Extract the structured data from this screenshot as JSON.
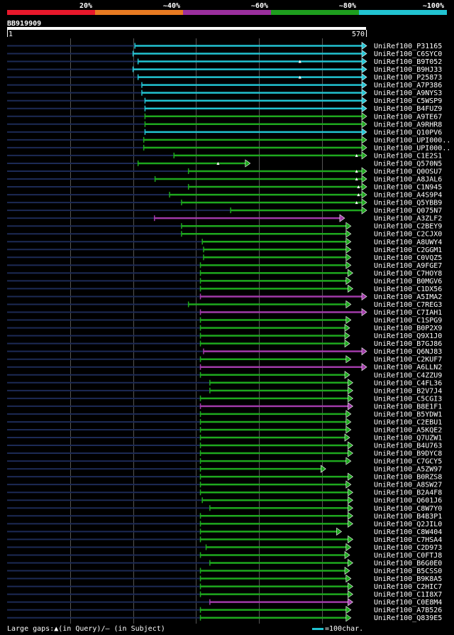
{
  "chart_data": {
    "type": "alignment-bars",
    "query_id": "BB919909",
    "query_length": 570,
    "query_start_label": "1",
    "query_end_label": "570",
    "identity_scale": [
      {
        "label": "20%",
        "color": "#e8182b"
      },
      {
        "label": "~40%",
        "color": "#e87b22"
      },
      {
        "label": "~60%",
        "color": "#9b2f9e"
      },
      {
        "label": "~80%",
        "color": "#1e9e1e"
      },
      {
        "label": "~100%",
        "color": "#22c3d1"
      }
    ],
    "hits": [
      {
        "name": "UniRef100_P31165",
        "start": 203,
        "end": 570,
        "color": "cyan"
      },
      {
        "name": "UniRef100_C6SYC0",
        "start": 200,
        "end": 570,
        "color": "cyan"
      },
      {
        "name": "UniRef100_B9T052",
        "start": 208,
        "end": 570,
        "color": "cyan",
        "gap_at": 465
      },
      {
        "name": "UniRef100_B9HJ33",
        "start": 200,
        "end": 570,
        "color": "cyan"
      },
      {
        "name": "UniRef100_P25873",
        "start": 208,
        "end": 570,
        "color": "cyan",
        "gap_at": 465
      },
      {
        "name": "UniRef100_A7P386",
        "start": 214,
        "end": 570,
        "color": "cyan"
      },
      {
        "name": "UniRef100_A9NYS3",
        "start": 214,
        "end": 570,
        "color": "cyan"
      },
      {
        "name": "UniRef100_C5WSP9",
        "start": 219,
        "end": 570,
        "color": "cyan"
      },
      {
        "name": "UniRef100_B4FUZ9",
        "start": 219,
        "end": 570,
        "color": "cyan"
      },
      {
        "name": "UniRef100_A9TE67",
        "start": 219,
        "end": 570,
        "color": "green"
      },
      {
        "name": "UniRef100_A9RHR8",
        "start": 219,
        "end": 570,
        "color": "green"
      },
      {
        "name": "UniRef100_Q10PV6",
        "start": 219,
        "end": 570,
        "color": "cyan"
      },
      {
        "name": "UniRef100_UPI000..",
        "start": 217,
        "end": 570,
        "color": "green"
      },
      {
        "name": "UniRef100_UPI000..",
        "start": 217,
        "end": 570,
        "color": "green"
      },
      {
        "name": "UniRef100_C1E2S1",
        "start": 265,
        "end": 570,
        "color": "green",
        "gap_at": 555
      },
      {
        "name": "UniRef100_Q570N5",
        "start": 208,
        "end": 385,
        "color": "green",
        "gap_at": 335
      },
      {
        "name": "UniRef100_Q0OSU7",
        "start": 288,
        "end": 570,
        "color": "green",
        "gap_at": 555
      },
      {
        "name": "UniRef100_A8JAL6",
        "start": 235,
        "end": 570,
        "color": "green",
        "gap_at": 555
      },
      {
        "name": "UniRef100_C1N945",
        "start": 288,
        "end": 570,
        "color": "green",
        "gap_at": 558
      },
      {
        "name": "UniRef100_A4S9P4",
        "start": 258,
        "end": 570,
        "color": "green",
        "gap_at": 558
      },
      {
        "name": "UniRef100_Q5YBB9",
        "start": 277,
        "end": 570,
        "color": "green",
        "gap_at": 555
      },
      {
        "name": "UniRef100_Q075N7",
        "start": 355,
        "end": 570,
        "color": "green"
      },
      {
        "name": "UniRef100_A3ZLF2",
        "start": 234,
        "end": 535,
        "color": "purple"
      },
      {
        "name": "UniRef100_C2BEY9",
        "start": 277,
        "end": 545,
        "color": "green"
      },
      {
        "name": "UniRef100_C2CJX0",
        "start": 277,
        "end": 545,
        "color": "green"
      },
      {
        "name": "UniRef100_A8UWY4",
        "start": 310,
        "end": 545,
        "color": "green"
      },
      {
        "name": "UniRef100_C2GGM1",
        "start": 312,
        "end": 545,
        "color": "green"
      },
      {
        "name": "UniRef100_C0VQZ5",
        "start": 312,
        "end": 545,
        "color": "green"
      },
      {
        "name": "UniRef100_A9FGE7",
        "start": 307,
        "end": 545,
        "color": "green"
      },
      {
        "name": "UniRef100_C7HOY8",
        "start": 307,
        "end": 548,
        "color": "green"
      },
      {
        "name": "UniRef100_B0MGV6",
        "start": 307,
        "end": 545,
        "color": "green"
      },
      {
        "name": "UniRef100_C1DX56",
        "start": 307,
        "end": 548,
        "color": "green"
      },
      {
        "name": "UniRef100_A5IMA2",
        "start": 307,
        "end": 570,
        "color": "purple"
      },
      {
        "name": "UniRef100_C7REG3",
        "start": 288,
        "end": 545,
        "color": "green"
      },
      {
        "name": "UniRef100_C7IAH1",
        "start": 307,
        "end": 570,
        "color": "purple"
      },
      {
        "name": "UniRef100_C1SPG9",
        "start": 307,
        "end": 545,
        "color": "green"
      },
      {
        "name": "UniRef100_B0P2X9",
        "start": 307,
        "end": 543,
        "color": "green"
      },
      {
        "name": "UniRef100_Q9X1J0",
        "start": 307,
        "end": 543,
        "color": "green"
      },
      {
        "name": "UniRef100_B7GJ86",
        "start": 307,
        "end": 543,
        "color": "green"
      },
      {
        "name": "UniRef100_Q6NJ83",
        "start": 312,
        "end": 570,
        "color": "purple"
      },
      {
        "name": "UniRef100_C2KUF7",
        "start": 307,
        "end": 545,
        "color": "green"
      },
      {
        "name": "UniRef100_A6LLN2",
        "start": 307,
        "end": 570,
        "color": "purple"
      },
      {
        "name": "UniRef100_C4ZZU9",
        "start": 307,
        "end": 543,
        "color": "green"
      },
      {
        "name": "UniRef100_C4FL36",
        "start": 322,
        "end": 548,
        "color": "green"
      },
      {
        "name": "UniRef100_B2V7J4",
        "start": 322,
        "end": 548,
        "color": "green"
      },
      {
        "name": "UniRef100_C5CGI3",
        "start": 307,
        "end": 548,
        "color": "green"
      },
      {
        "name": "UniRef100_B8E1F1",
        "start": 307,
        "end": 548,
        "color": "purple"
      },
      {
        "name": "UniRef100_B5YDW1",
        "start": 307,
        "end": 545,
        "color": "green"
      },
      {
        "name": "UniRef100_C2EBU1",
        "start": 307,
        "end": 545,
        "color": "green"
      },
      {
        "name": "UniRef100_A5KQE2",
        "start": 307,
        "end": 545,
        "color": "green"
      },
      {
        "name": "UniRef100_Q7UZW1",
        "start": 307,
        "end": 543,
        "color": "green"
      },
      {
        "name": "UniRef100_B4U763",
        "start": 307,
        "end": 548,
        "color": "green"
      },
      {
        "name": "UniRef100_B9DYC8",
        "start": 307,
        "end": 548,
        "color": "green"
      },
      {
        "name": "UniRef100_C7GCY5",
        "start": 307,
        "end": 545,
        "color": "green"
      },
      {
        "name": "UniRef100_A5ZW97",
        "start": 307,
        "end": 505,
        "color": "green"
      },
      {
        "name": "UniRef100_B0RZS8",
        "start": 307,
        "end": 548,
        "color": "green"
      },
      {
        "name": "UniRef100_A8SW27",
        "start": 307,
        "end": 545,
        "color": "green"
      },
      {
        "name": "UniRef100_B2A4F8",
        "start": 307,
        "end": 548,
        "color": "green"
      },
      {
        "name": "UniRef100_Q601J6",
        "start": 310,
        "end": 548,
        "color": "green"
      },
      {
        "name": "UniRef100_C8W7Y0",
        "start": 322,
        "end": 548,
        "color": "green"
      },
      {
        "name": "UniRef100_B4B3P1",
        "start": 307,
        "end": 548,
        "color": "green"
      },
      {
        "name": "UniRef100_Q2JIL0",
        "start": 307,
        "end": 548,
        "color": "green"
      },
      {
        "name": "UniRef100_C8W404",
        "start": 307,
        "end": 530,
        "color": "green"
      },
      {
        "name": "UniRef100_C7HSA4",
        "start": 307,
        "end": 548,
        "color": "green"
      },
      {
        "name": "UniRef100_C2D973",
        "start": 316,
        "end": 545,
        "color": "green"
      },
      {
        "name": "UniRef100_C0FTJ8",
        "start": 307,
        "end": 543,
        "color": "green"
      },
      {
        "name": "UniRef100_B6G0E0",
        "start": 322,
        "end": 548,
        "color": "green"
      },
      {
        "name": "UniRef100_B5CSS0",
        "start": 307,
        "end": 543,
        "color": "green"
      },
      {
        "name": "UniRef100_B9K8A5",
        "start": 307,
        "end": 545,
        "color": "green"
      },
      {
        "name": "UniRef100_C2HIC7",
        "start": 307,
        "end": 548,
        "color": "green"
      },
      {
        "name": "UniRef100_C1I8X7",
        "start": 307,
        "end": 548,
        "color": "green"
      },
      {
        "name": "UniRef100_C0E8M4",
        "start": 322,
        "end": 548,
        "color": "purple"
      },
      {
        "name": "UniRef100_A7B526",
        "start": 307,
        "end": 545,
        "color": "green"
      },
      {
        "name": "UniRef100_Q839E5",
        "start": 307,
        "end": 545,
        "color": "green"
      }
    ]
  },
  "footer": {
    "gaps_text": "Large gaps:▲(in Query)/– (in Subject)",
    "scale_text": "=100char."
  },
  "colors": {
    "cyan": "#22c3d1",
    "green": "#1ea81e",
    "purple": "#a03aa8",
    "background_line": "#1c2a55",
    "query_bar": "#ffffff",
    "grid": "#555555"
  }
}
